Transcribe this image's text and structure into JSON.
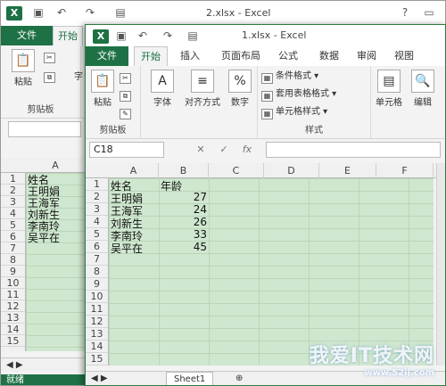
{
  "back": {
    "title": "2.xlsx - Excel",
    "tabs": [
      "文件",
      "开始"
    ],
    "paste_label": "粘贴",
    "font_label_partial": "字",
    "clipboard_group": "剪贴板",
    "col_a": "A",
    "rows": [
      "1",
      "2",
      "3",
      "4",
      "5",
      "6",
      "7",
      "8",
      "9",
      "10",
      "11",
      "12",
      "13",
      "14",
      "15"
    ],
    "names": [
      "姓名",
      "王明娟",
      "王海军",
      "刘新生",
      "李南玲",
      "吴平在"
    ],
    "status": "就绪"
  },
  "front": {
    "title": "1.xlsx - Excel",
    "tabs": [
      "文件",
      "开始",
      "插入",
      "页面布局",
      "公式",
      "数据",
      "审阅",
      "视图"
    ],
    "ribbon": {
      "paste_label": "粘贴",
      "clipboard_group": "剪贴板",
      "font_label": "字体",
      "align_label": "对齐方式",
      "number_label": "数字",
      "cond_format": "条件格式",
      "table_format": "套用表格格式",
      "cell_style": "单元格样式",
      "styles_group": "样式",
      "cells_label": "单元格",
      "edit_label": "编辑"
    },
    "namebox": "C18",
    "fx": "fx",
    "cols": [
      "A",
      "B",
      "C",
      "D",
      "E",
      "F"
    ],
    "rows": [
      "1",
      "2",
      "3",
      "4",
      "5",
      "6",
      "7",
      "8",
      "9",
      "10",
      "11",
      "12",
      "13",
      "14",
      "15"
    ],
    "data": {
      "header_name": "姓名",
      "header_age": "年龄",
      "names": [
        "王明娟",
        "王海军",
        "刘新生",
        "李南玲",
        "吴平在"
      ],
      "ages": [
        "27",
        "24",
        "26",
        "33",
        "45"
      ]
    },
    "sheet_tab": "Sheet1"
  },
  "watermark": {
    "main": "我爱IT技术网",
    "sub": "www.52ij.com"
  }
}
